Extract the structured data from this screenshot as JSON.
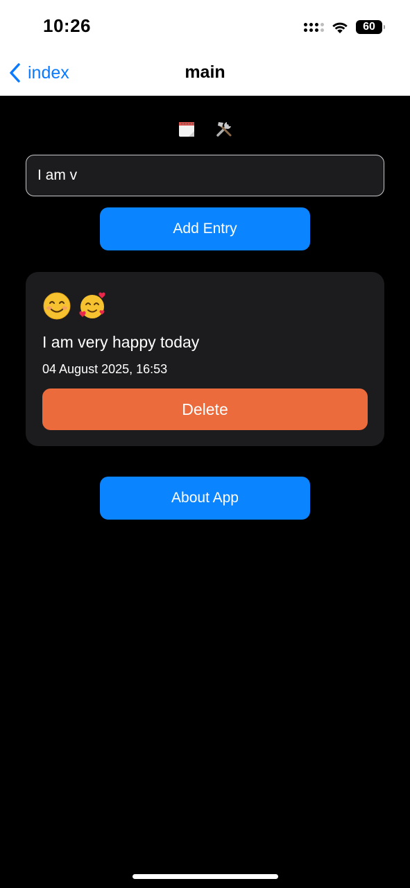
{
  "status_bar": {
    "time": "10:26",
    "battery_level": "60",
    "icons": [
      "signal-icon",
      "wifi-icon",
      "battery-icon"
    ]
  },
  "nav": {
    "back_label": "index",
    "title": "main",
    "back_icon": "chevron-left-icon"
  },
  "toolbar": {
    "icons": [
      "calendar-icon",
      "tools-icon"
    ]
  },
  "entry_form": {
    "input_value": "I am v",
    "add_label": "Add Entry"
  },
  "entries": [
    {
      "emojis": [
        "smiling-face-icon",
        "smiling-face-with-hearts-icon"
      ],
      "text": "I am very happy today",
      "date": "04 August 2025, 16:53",
      "delete_label": "Delete"
    }
  ],
  "about_label": "About App",
  "colors": {
    "accent_blue": "#0a84ff",
    "delete_orange": "#ec6b3c",
    "card_bg": "#1c1c1e",
    "background": "#000000",
    "link_blue": "#0a7aff"
  }
}
